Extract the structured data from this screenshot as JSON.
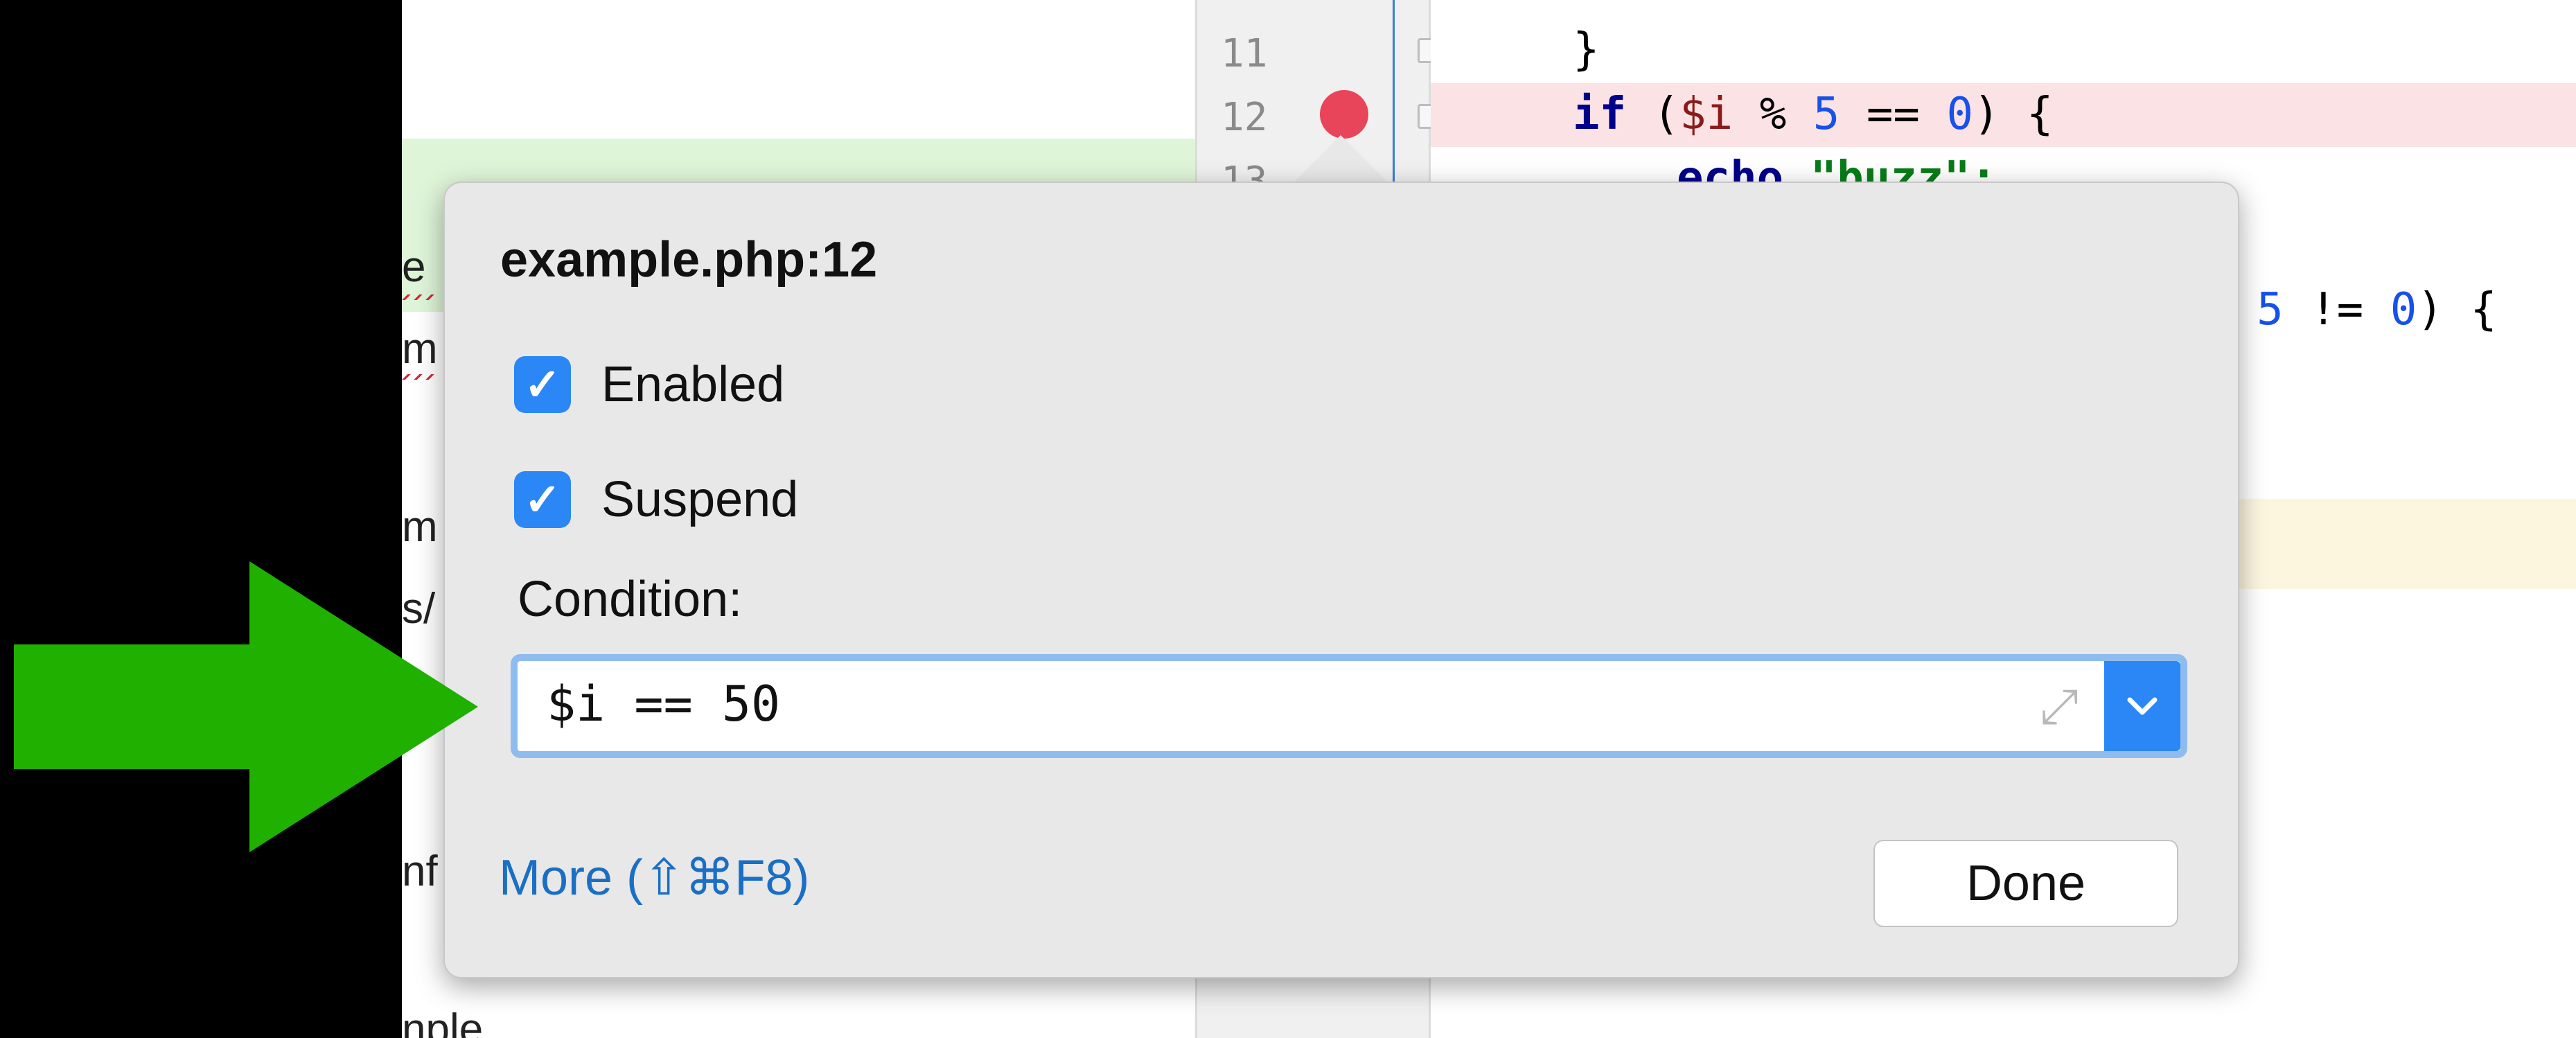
{
  "doc": {
    "fragments": [
      "e",
      "m",
      "m",
      "s/",
      "nf",
      "nple"
    ]
  },
  "gutter": {
    "line_numbers": [
      "11",
      "12",
      "13"
    ]
  },
  "editor": {
    "lines": {
      "l1": "}",
      "l2_kw": "if",
      "l2_a": " (",
      "l2_var": "$i",
      "l2_b": " % ",
      "l2_num1": "5",
      "l2_c": " == ",
      "l2_num2": "0",
      "l2_d": ") {",
      "l3_kw": "echo",
      "l3_str": "\"buzz\";",
      "l4_a": "% ",
      "l4_num1": "5",
      "l4_b": " != ",
      "l4_num2": "0",
      "l4_c": ") {"
    }
  },
  "popup": {
    "title": "example.php:12",
    "enabled_label": "Enabled",
    "enabled_checked": true,
    "suspend_label": "Suspend",
    "suspend_checked": true,
    "condition_label": "Condition:",
    "condition_value": "$i == 50",
    "more_label": "More (⇧⌘F8)",
    "done_label": "Done"
  },
  "icons": {
    "checkmark": "check-icon",
    "expand": "expand-icon",
    "dropdown": "chevron-down-icon",
    "breakpoint": "breakpoint-icon",
    "annotation_arrow": "arrow-right-icon"
  },
  "colors": {
    "accent": "#2a87f5",
    "breakpoint": "#e8445a",
    "arrow": "#1fb000",
    "link": "#1a6fc4"
  }
}
